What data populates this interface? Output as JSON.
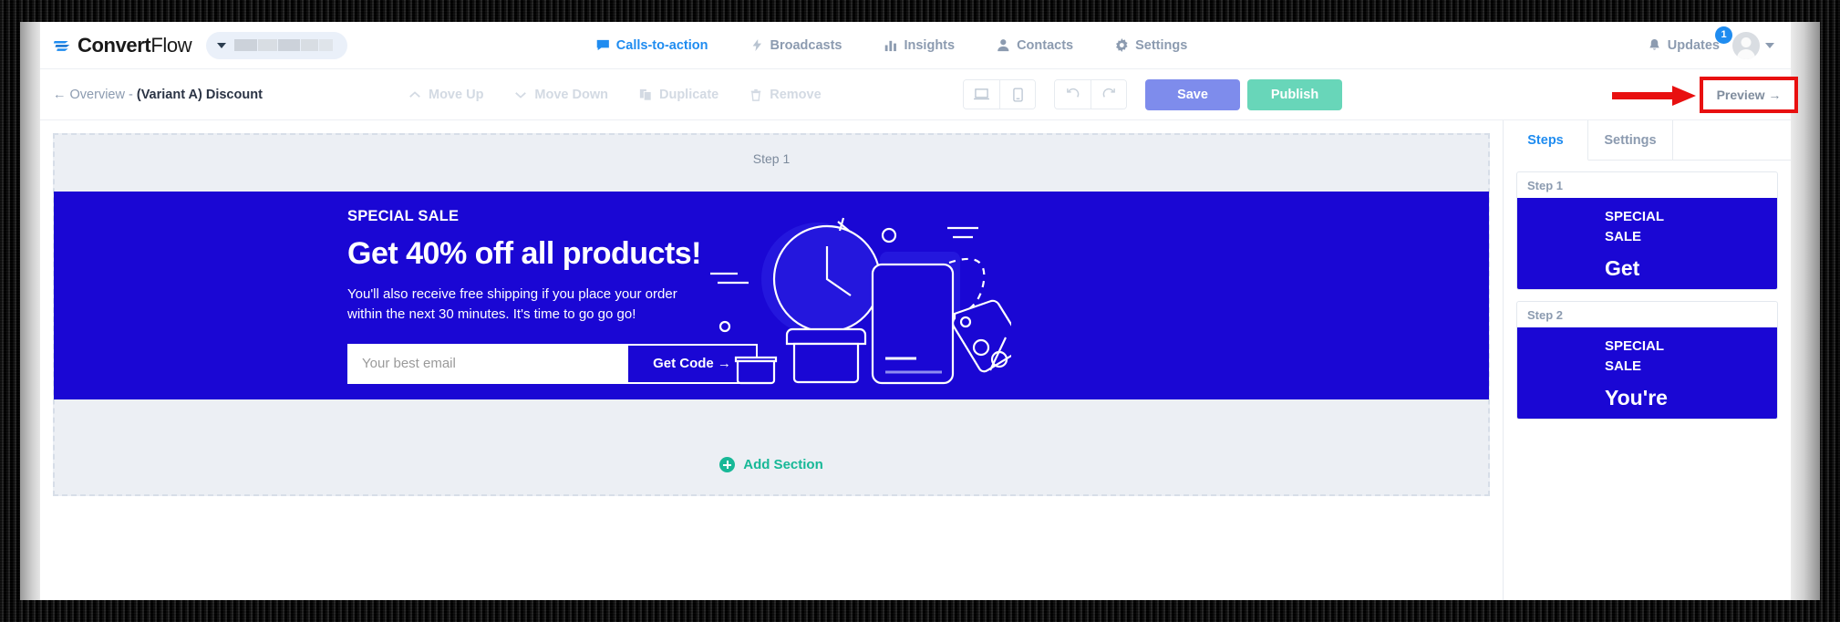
{
  "brand": {
    "name_bold": "Convert",
    "name_light": "Flow",
    "logo_icon": "convertflow-wing-logo",
    "accent_blue": "#1f8cf0",
    "cta_blue": "#1a07d4",
    "save_color": "#7e8cec",
    "publish_color": "#68d6b9",
    "highlight_color": "#e81010"
  },
  "topnav": {
    "site_selector": {
      "icon": "chevron-down-icon",
      "value_redacted": true
    },
    "links": [
      {
        "label": "Calls-to-action",
        "icon": "speech-bubble-icon",
        "active": true
      },
      {
        "label": "Broadcasts",
        "icon": "lightning-bolt-icon",
        "active": false
      },
      {
        "label": "Insights",
        "icon": "bar-chart-icon",
        "active": false
      },
      {
        "label": "Contacts",
        "icon": "person-icon",
        "active": false
      },
      {
        "label": "Settings",
        "icon": "gear-icon",
        "active": false
      }
    ],
    "updates": {
      "label": "Updates",
      "icon": "bell-icon",
      "badge_count": "1"
    },
    "account": {
      "icon": "avatar-icon",
      "caret": "chevron-down-icon"
    }
  },
  "toolbar": {
    "breadcrumb": {
      "back_label": "← Overview",
      "separator": " - ",
      "current": "(Variant A) Discount"
    },
    "actions": [
      {
        "label": "Move Up",
        "icon": "chevron-up-icon"
      },
      {
        "label": "Move Down",
        "icon": "chevron-down-icon"
      },
      {
        "label": "Duplicate",
        "icon": "copy-icon"
      },
      {
        "label": "Remove",
        "icon": "trash-icon"
      }
    ],
    "device_toggle": [
      {
        "icon": "desktop-icon",
        "active": true
      },
      {
        "icon": "mobile-icon",
        "active": false
      }
    ],
    "history": [
      {
        "icon": "undo-icon"
      },
      {
        "icon": "redo-icon"
      }
    ],
    "save_label": "Save",
    "publish_label": "Publish",
    "preview_label": "Preview →"
  },
  "canvas": {
    "step_label": "Step 1",
    "cta": {
      "eyebrow": "SPECIAL SALE",
      "headline": "Get 40% off all products!",
      "subcopy": "You'll also receive free shipping if you place your order within the next 30 minutes. It's time to go go go!",
      "email_placeholder": "Your best email",
      "email_value": "",
      "submit_label": "Get Code →",
      "illustration": "clock-phone-pricetag-illustration"
    },
    "add_section_label": "Add Section",
    "add_section_icon": "plus-circle-icon"
  },
  "panel": {
    "tabs": [
      {
        "label": "Steps",
        "active": true
      },
      {
        "label": "Settings",
        "active": false
      }
    ],
    "steps": [
      {
        "title": "Step 1",
        "thumb_eyebrow": "SPECIAL SALE",
        "thumb_headline": "Get"
      },
      {
        "title": "Step 2",
        "thumb_eyebrow": "SPECIAL SALE",
        "thumb_headline": "You're"
      }
    ]
  }
}
